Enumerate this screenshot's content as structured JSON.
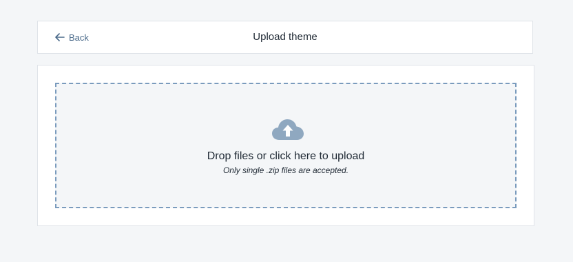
{
  "header": {
    "back_label": "Back",
    "title": "Upload theme",
    "back_icon": "arrow-left-icon"
  },
  "dropzone": {
    "icon": "cloud-upload-icon",
    "primary_text": "Drop files or click here to upload",
    "hint_text": "Only single .zip files are accepted."
  },
  "colors": {
    "background": "#f4f6f8",
    "card": "#ffffff",
    "border": "#dfe3e8",
    "accent": "#4a6a8a",
    "dash": "#7a9bbd",
    "icon": "#8fa8c0",
    "text": "#212b36"
  }
}
